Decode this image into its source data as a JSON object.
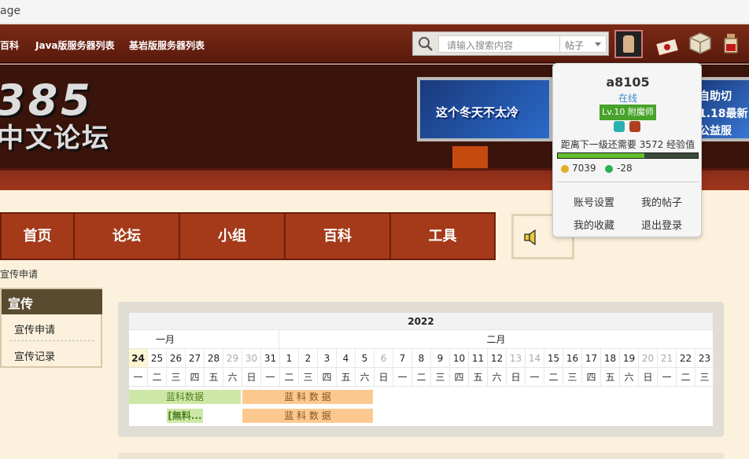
{
  "browser": {
    "title": "age"
  },
  "topnav": {
    "links": [
      "百科",
      "Java版服务器列表",
      "基岩版服务器列表"
    ],
    "search_placeholder": "请输入搜索内容",
    "search_type": "帖子"
  },
  "banner": {
    "logo_main": "385",
    "logo_sub": "中文论坛",
    "ad1_text": "这个冬天不太冷",
    "ad2_lines": [
      "自助切",
      "1.18最新",
      "公益服"
    ]
  },
  "mainnav": {
    "items": [
      "首页",
      "论坛",
      "小组",
      "百科",
      "工具"
    ]
  },
  "breadcrumb": "宣传申请",
  "sidebar": {
    "heading": "宣传",
    "items": [
      "宣传申请",
      "宣传记录"
    ]
  },
  "calendar": {
    "year": "2022",
    "months": [
      "一月",
      "二月"
    ],
    "days": [
      "24",
      "25",
      "26",
      "27",
      "28",
      "29",
      "30",
      "31",
      "1",
      "2",
      "3",
      "4",
      "5",
      "6",
      "7",
      "8",
      "9",
      "10",
      "11",
      "12",
      "13",
      "14",
      "15",
      "16",
      "17",
      "18",
      "19",
      "20",
      "21",
      "22",
      "23"
    ],
    "weekdays": [
      "一",
      "二",
      "三",
      "四",
      "五",
      "六",
      "日",
      "一",
      "二",
      "三",
      "四",
      "五",
      "六",
      "日",
      "一",
      "二",
      "三",
      "四",
      "五",
      "六",
      "日",
      "一",
      "二",
      "三",
      "四",
      "五",
      "六",
      "日",
      "一",
      "二",
      "三"
    ],
    "bars": {
      "green1": "蓝科数据",
      "green2": "[無料...",
      "orange1": "蓝 科 数 据",
      "orange2": "蓝 科 数 据"
    }
  },
  "user_popup": {
    "username": "a8105",
    "status": "在线",
    "level": "Lv.10 附魔师",
    "exp_text": "距离下一级还需要 3572 经验值",
    "exp_progress": 0.62,
    "gold": "7039",
    "emerald": "-28",
    "actions": [
      "账号设置",
      "我的帖子",
      "我的收藏",
      "退出登录"
    ]
  },
  "colors": {
    "nav_bg": "#a43a1a",
    "accent_green": "#47a32a",
    "link_blue": "#3a8ad0"
  }
}
